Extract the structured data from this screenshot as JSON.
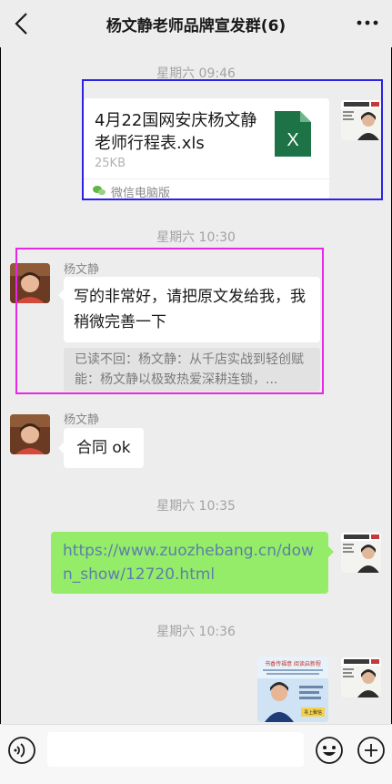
{
  "header": {
    "title": "杨文静老师品牌宣发群(6)"
  },
  "timestamps": [
    "星期六 09:46",
    "星期六 10:30",
    "星期六 10:35",
    "星期六 10:36"
  ],
  "file_message": {
    "name": "4月22国网安庆杨文静老师行程表.xls",
    "size": "25KB",
    "source": "微信电脑版",
    "icon_letter": "X"
  },
  "messages": [
    {
      "sender": "杨文静",
      "text": "写的非常好，请把原文发给我，我稍微完善一下",
      "quote": "已读不回：杨文静：从千店实战到轻创赋能：杨文静以极致热爱深耕连锁，..."
    },
    {
      "sender": "杨文静",
      "text": "合同 ok"
    },
    {
      "text": "https://www.zuozhebang.cn/down_show/12720.html"
    }
  ],
  "image_message": {
    "line1": "书香传福意 阅读启新程",
    "line2": "寻上致信"
  },
  "colors": {
    "accent_green": "#95ec69",
    "link": "#5c7fa8",
    "excel": "#1d7345"
  }
}
